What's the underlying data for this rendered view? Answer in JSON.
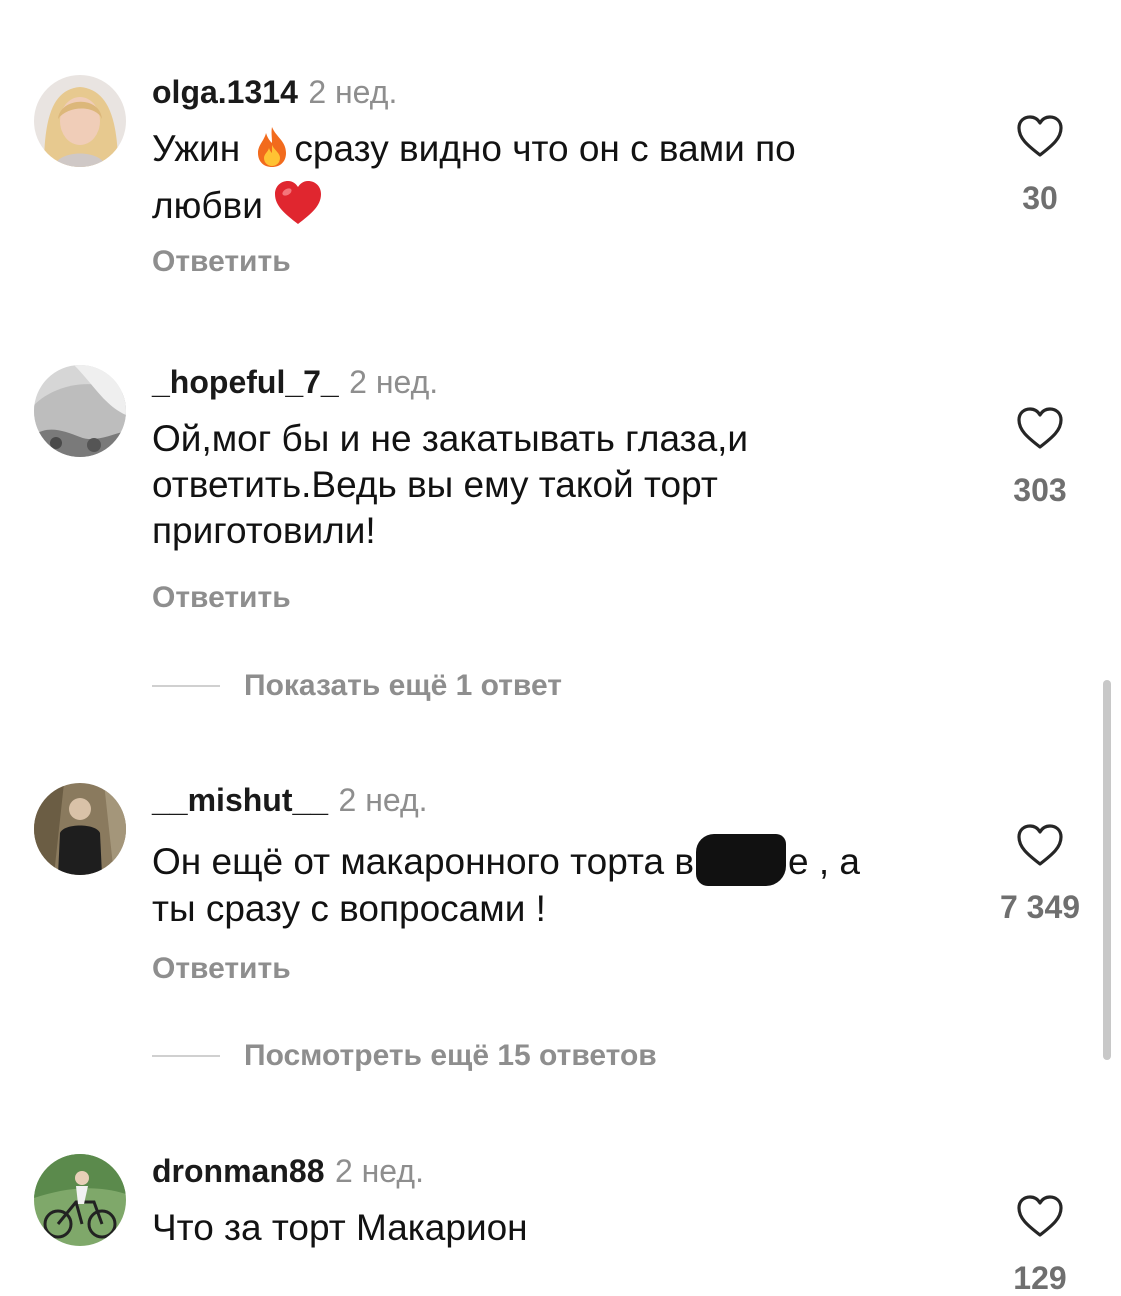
{
  "comments": [
    {
      "username": "olga.1314",
      "time": "2 нед.",
      "text_part1": "Ужин",
      "text_part2": "сразу видно что он с вами по",
      "text_part3": "любви",
      "likes": "30",
      "reply_label": "Ответить",
      "avatar_icon": "avatar-woman-blonde"
    },
    {
      "username": "_hopeful_7_",
      "time": "2 нед.",
      "text": "Ой,мог бы и не закатывать глаза,и ответить.Ведь вы ему такой торт приготовили!",
      "likes": "303",
      "reply_label": "Ответить",
      "more_replies": "Показать ещё 1 ответ",
      "avatar_icon": "avatar-grey-photo"
    },
    {
      "username": "__mishut__",
      "time": "2 нед.",
      "text_part1": "Он ещё от макаронного торта в",
      "text_part2": "е , а",
      "text_part3": "ты сразу с вопросами !",
      "likes": "7 349",
      "reply_label": "Ответить",
      "more_replies": "Посмотреть ещё 15 ответов",
      "avatar_icon": "avatar-man-forest"
    },
    {
      "username": "dronman88",
      "time": "2 нед.",
      "text": "Что за торт Макарион",
      "likes": "129",
      "avatar_icon": "avatar-cyclist"
    }
  ],
  "icons": {
    "like": "heart-outline-icon",
    "emoji_fire": "fire-emoji",
    "emoji_heart": "red-heart-emoji"
  },
  "colors": {
    "username": "#1a1a1a",
    "secondary": "#8e8e8e",
    "heart_emoji": "#e0262f"
  }
}
